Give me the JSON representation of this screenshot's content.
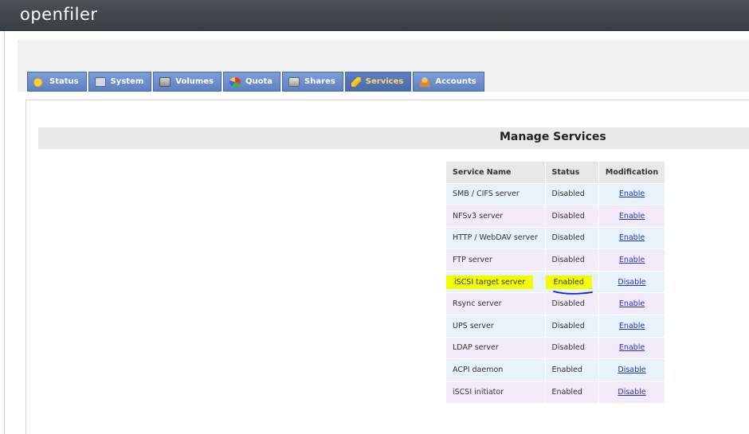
{
  "app": {
    "logo": "openfiler"
  },
  "tabs": [
    {
      "label": "Status",
      "icon": "sun-icon"
    },
    {
      "label": "System",
      "icon": "monitor-icon"
    },
    {
      "label": "Volumes",
      "icon": "disk-icon"
    },
    {
      "label": "Quota",
      "icon": "pie-icon"
    },
    {
      "label": "Shares",
      "icon": "drive-icon"
    },
    {
      "label": "Services",
      "icon": "lightning-icon",
      "active": true
    },
    {
      "label": "Accounts",
      "icon": "user-icon"
    }
  ],
  "page": {
    "title": "Manage Services"
  },
  "table": {
    "headers": [
      "Service Name",
      "Status",
      "Modification"
    ],
    "rows": [
      {
        "name": "SMB / CIFS server",
        "status": "Disabled",
        "action": "Enable"
      },
      {
        "name": "NFSv3 server",
        "status": "Disabled",
        "action": "Enable"
      },
      {
        "name": "HTTP / WebDAV server",
        "status": "Disabled",
        "action": "Enable"
      },
      {
        "name": "FTP server",
        "status": "Disabled",
        "action": "Enable"
      },
      {
        "name": "iSCSI target server",
        "status": "Enabled",
        "action": "Disable",
        "highlighted": true
      },
      {
        "name": "Rsync server",
        "status": "Disabled",
        "action": "Enable"
      },
      {
        "name": "UPS server",
        "status": "Disabled",
        "action": "Enable"
      },
      {
        "name": "LDAP server",
        "status": "Disabled",
        "action": "Enable"
      },
      {
        "name": "ACPI daemon",
        "status": "Enabled",
        "action": "Disable"
      },
      {
        "name": "iSCSI initiator",
        "status": "Enabled",
        "action": "Disable"
      }
    ]
  },
  "colors": {
    "highlight": "#f2ff00",
    "annotation": "#0a1fd6",
    "tab": "#6a8cce",
    "active_tab_text": "#ffd86b"
  }
}
